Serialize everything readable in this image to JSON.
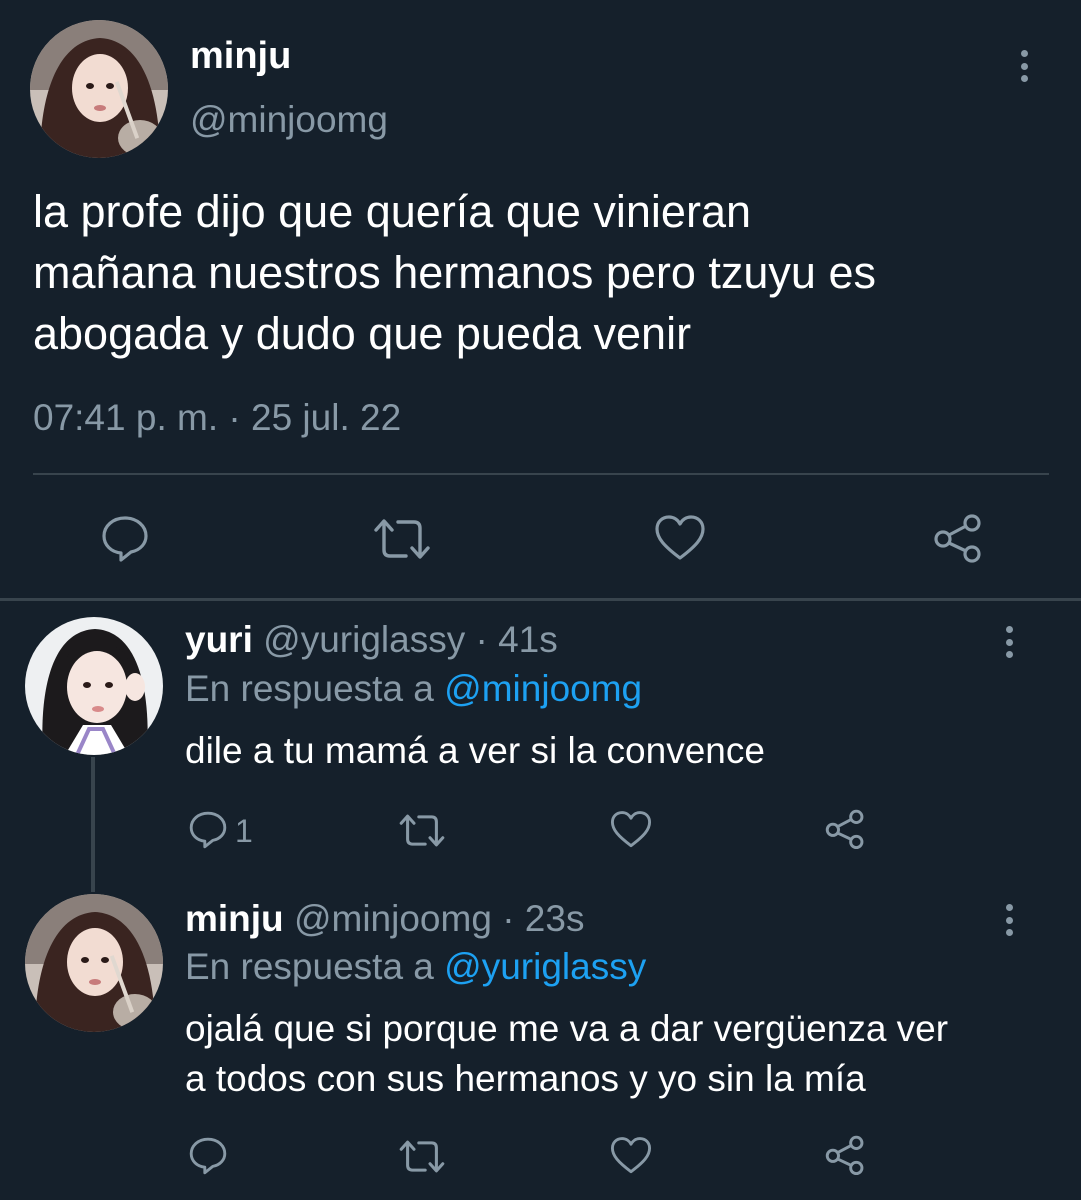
{
  "main_tweet": {
    "name": "minju",
    "handle": "@minjoomg",
    "text": "la profe dijo que quería que vinieran\nmañana nuestros hermanos pero tzuyu es\nabogada y dudo que pueda venir",
    "timestamp": "07:41 p. m. · 25 jul. 22",
    "actions": [
      "reply-icon",
      "retweet-icon",
      "like-icon",
      "share-icon"
    ]
  },
  "replies": [
    {
      "name": "yuri",
      "handle": "@yuriglassy",
      "time": "· 41s",
      "reply_prefix": "En respuesta a",
      "reply_to": "@minjoomg",
      "text": "dile a tu mamá a ver si la convence",
      "reply_count": "1"
    },
    {
      "name": "minju",
      "handle": "@minjoomg",
      "time": "· 23s",
      "reply_prefix": "En respuesta a",
      "reply_to": "@yuriglassy",
      "text": "ojalá que si porque me va a dar vergüenza ver\na todos con sus hermanos y yo sin la mía",
      "reply_count": ""
    }
  ],
  "colors": {
    "background": "#15202b",
    "secondary_text": "#8899a6",
    "link": "#1da1f2",
    "divider": "#38444d"
  }
}
